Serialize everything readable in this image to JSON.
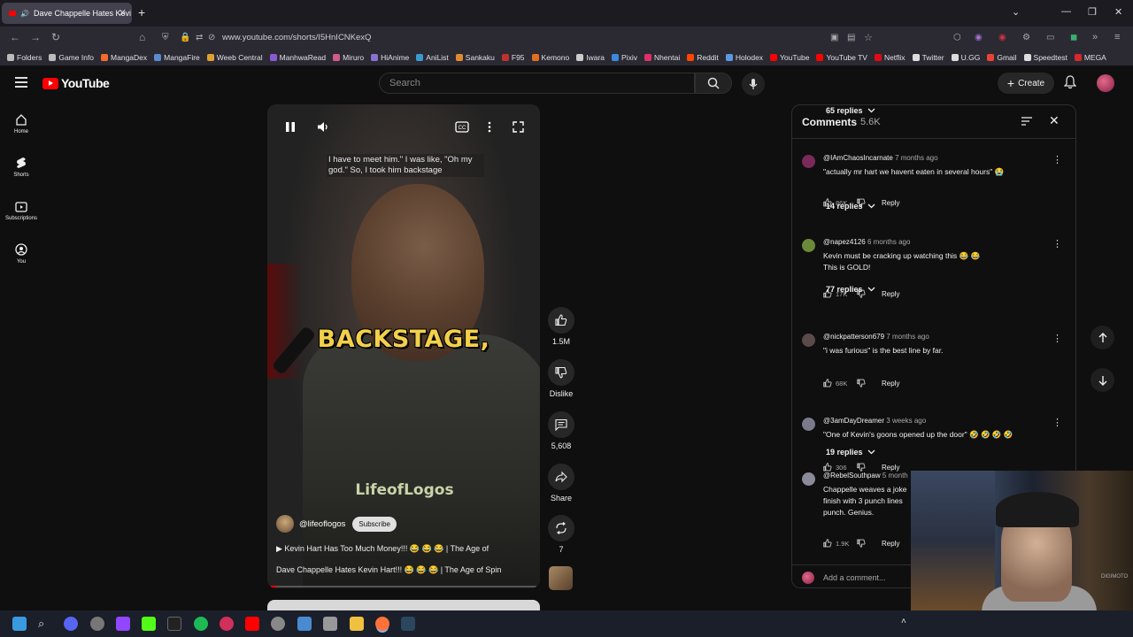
{
  "browser": {
    "tab_title": "Dave Chappelle Hates Kevi",
    "url": "www.youtube.com/shorts/I5HnICNKexQ",
    "bookmarks": [
      {
        "label": "Folders",
        "color": "#bbbbbb"
      },
      {
        "label": "Game Info",
        "color": "#bbbbbb"
      },
      {
        "label": "MangaDex",
        "color": "#f56b2a"
      },
      {
        "label": "MangaFire",
        "color": "#5a8ad0"
      },
      {
        "label": "Weeb Central",
        "color": "#e0a030"
      },
      {
        "label": "ManhwaRead",
        "color": "#8a5ad0"
      },
      {
        "label": "Miruro",
        "color": "#d05a8a"
      },
      {
        "label": "HiAnime",
        "color": "#8a70d0"
      },
      {
        "label": "AniList",
        "color": "#3a9ad0"
      },
      {
        "label": "Sankaku",
        "color": "#e08a30"
      },
      {
        "label": "F95",
        "color": "#c03030"
      },
      {
        "label": "Kemono",
        "color": "#e07020"
      },
      {
        "label": "Iwara",
        "color": "#cccccc"
      },
      {
        "label": "Pixiv",
        "color": "#3a8ae0"
      },
      {
        "label": "Nhentai",
        "color": "#e0306a"
      },
      {
        "label": "Reddit",
        "color": "#ff4500"
      },
      {
        "label": "Holodex",
        "color": "#5a9ae0"
      },
      {
        "label": "YouTube",
        "color": "#ff0000"
      },
      {
        "label": "YouTube TV",
        "color": "#ff0000"
      },
      {
        "label": "Netflix",
        "color": "#e50914"
      },
      {
        "label": "Twitter",
        "color": "#dddddd"
      },
      {
        "label": "U.GG",
        "color": "#dddddd"
      },
      {
        "label": "Gmail",
        "color": "#ea4335"
      },
      {
        "label": "Speedtest",
        "color": "#dddddd"
      },
      {
        "label": "MEGA",
        "color": "#d9272e"
      }
    ]
  },
  "youtube": {
    "logo_text": "YouTube",
    "search_placeholder": "Search",
    "create_label": "Create",
    "nav": [
      {
        "label": "Home"
      },
      {
        "label": "Shorts"
      },
      {
        "label": "Subscriptions"
      },
      {
        "label": "You"
      }
    ]
  },
  "video": {
    "caption": "I have to meet him.\" I was like, \"Oh my god.\" So, I took him backstage",
    "overlay_word": "BACKSTAGE,",
    "watermark": "LifeofLogos",
    "channel": "@lifeoflogos",
    "subscribe_label": "Subscribe",
    "title_line1": "▶  Kevin Hart Has Too Much Money!!! 😂 😂 😂 | The Age of",
    "title_line2": "Dave Chappelle Hates Kevin Hart!!! 😂 😂 😂 | The Age of Spin",
    "progress_fraction": 0.02
  },
  "actions": {
    "likes": "1.5M",
    "dislike_label": "Dislike",
    "comments": "5,608",
    "share_label": "Share",
    "remix_count": "7"
  },
  "comments": {
    "title": "Comments",
    "count": "5.6K",
    "add_placeholder": "Add a comment...",
    "reply_label": "Reply",
    "items": [
      {
        "user": "@IAmChaosIncarnate",
        "time": "7 months ago",
        "text1": "\"actually mr hart we havent eaten in several hours\" 😭",
        "text2": "",
        "likes": "86K",
        "replies": "65 replies",
        "avatar_color": "#7a2a5a"
      },
      {
        "user": "@napez4126",
        "time": "6 months ago",
        "text1": "Kevin must be cracking up watching this 😂 😂",
        "text2": "This is GOLD!",
        "likes": "17K",
        "replies": "14 replies",
        "avatar_color": "#6a8a3a"
      },
      {
        "user": "@nickpatterson679",
        "time": "7 months ago",
        "text1": "\"i was furious\" is the best line by far.",
        "text2": "",
        "likes": "68K",
        "replies": "77 replies",
        "avatar_color": "#5a4a4a"
      },
      {
        "user": "@3amDayDreamer",
        "time": "3 weeks ago",
        "text1": "\"One of Kevin's goons opened up the door\" 🤣 🤣 🤣 🤣",
        "text2": "",
        "likes": "306",
        "replies": "",
        "avatar_color": "#7a7a8a"
      },
      {
        "user": "@RebelSouthpaw",
        "time": "5 month",
        "text1": "Chappelle weaves a joke",
        "text2": "finish with 3 punch lines",
        "text3": "punch. Genius.",
        "likes": "1.9K",
        "replies": "19 replies",
        "avatar_color": "#8a8a9a"
      }
    ]
  },
  "webcam_text": "DIGIMOTO"
}
